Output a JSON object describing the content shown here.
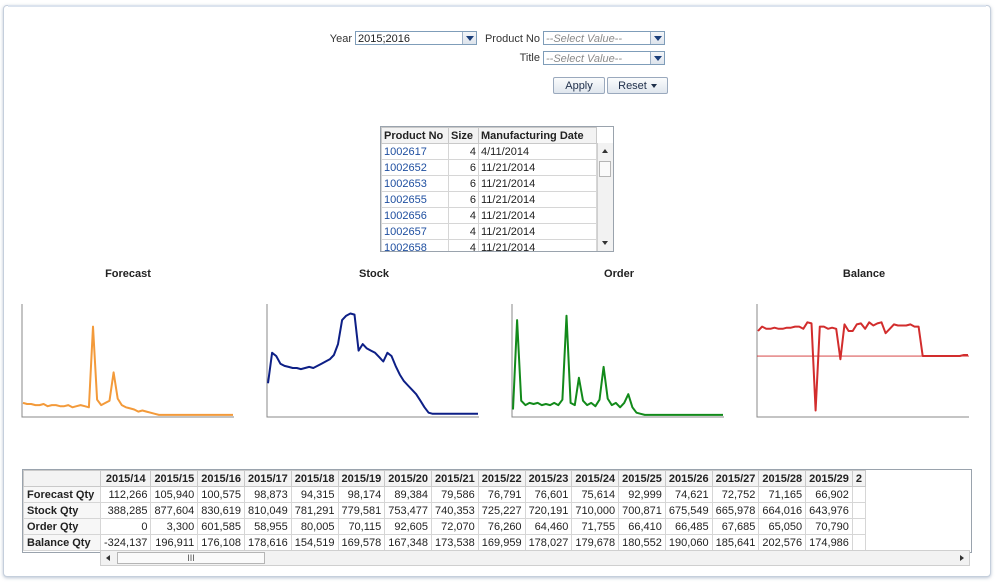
{
  "filters": {
    "year_label": "Year",
    "year_value": "2015;2016",
    "product_label": "Product No",
    "product_placeholder": "--Select Value--",
    "title_label": "Title",
    "title_placeholder": "--Select Value--",
    "apply_label": "Apply",
    "reset_label": "Reset"
  },
  "products": {
    "headers": [
      "Product No",
      "Size",
      "Manufacturing Date"
    ],
    "rows": [
      [
        "1002617",
        "4",
        "4/11/2014"
      ],
      [
        "1002652",
        "6",
        "11/21/2014"
      ],
      [
        "1002653",
        "6",
        "11/21/2014"
      ],
      [
        "1002655",
        "6",
        "11/21/2014"
      ],
      [
        "1002656",
        "4",
        "11/21/2014"
      ],
      [
        "1002657",
        "4",
        "11/21/2014"
      ],
      [
        "1002658",
        "4",
        "11/21/2014"
      ]
    ]
  },
  "charts": {
    "forecast": {
      "title": "Forecast",
      "color": "#f39a3a"
    },
    "stock": {
      "title": "Stock",
      "color": "#0d1f86"
    },
    "order": {
      "title": "Order",
      "color": "#128a1a"
    },
    "balance": {
      "title": "Balance",
      "color": "#d22d2d"
    }
  },
  "chart_data": [
    {
      "type": "line",
      "title": "Forecast",
      "values": [
        12,
        11,
        11,
        10,
        10,
        11,
        9,
        10,
        10,
        9,
        9,
        10,
        8,
        9,
        10,
        9,
        8,
        82,
        15,
        10,
        12,
        14,
        40,
        16,
        10,
        8,
        7,
        6,
        4,
        5,
        4,
        3,
        2,
        1,
        1,
        1,
        1,
        1,
        1,
        1,
        1,
        1,
        1,
        1,
        1,
        1,
        1,
        1,
        1,
        1,
        1,
        1
      ]
    },
    {
      "type": "line",
      "title": "Stock",
      "values": [
        30,
        58,
        55,
        48,
        46,
        45,
        44,
        44,
        43,
        44,
        45,
        44,
        46,
        48,
        50,
        52,
        56,
        66,
        88,
        92,
        94,
        93,
        60,
        66,
        62,
        60,
        58,
        54,
        50,
        58,
        55,
        46,
        38,
        32,
        28,
        24,
        20,
        14,
        8,
        3,
        2,
        2,
        2,
        2,
        2,
        2,
        2,
        2,
        2,
        2,
        2,
        2
      ]
    },
    {
      "type": "line",
      "title": "Order",
      "values": [
        6,
        88,
        14,
        10,
        12,
        11,
        12,
        10,
        11,
        10,
        12,
        10,
        15,
        92,
        12,
        10,
        35,
        14,
        10,
        12,
        9,
        15,
        45,
        16,
        10,
        12,
        8,
        12,
        20,
        8,
        3,
        2,
        1,
        1,
        1,
        1,
        1,
        1,
        1,
        1,
        1,
        1,
        1,
        1,
        1,
        1,
        1,
        1,
        1,
        1,
        1,
        1
      ]
    },
    {
      "type": "line",
      "title": "Balance",
      "values": [
        78,
        82,
        80,
        80,
        81,
        80,
        80,
        81,
        81,
        82,
        82,
        80,
        86,
        85,
        5,
        82,
        82,
        80,
        81,
        80,
        52,
        84,
        78,
        78,
        84,
        85,
        80,
        86,
        83,
        85,
        86,
        76,
        80,
        84,
        83,
        83,
        83,
        84,
        82,
        82,
        55,
        55,
        55,
        55,
        55,
        55,
        55,
        55,
        55,
        55,
        56,
        56
      ],
      "reference_line": true
    }
  ],
  "data_table": {
    "columns": [
      "2015/14",
      "2015/15",
      "2015/16",
      "2015/17",
      "2015/18",
      "2015/19",
      "2015/20",
      "2015/21",
      "2015/22",
      "2015/23",
      "2015/24",
      "2015/25",
      "2015/26",
      "2015/27",
      "2015/28",
      "2015/29",
      "2"
    ],
    "rows": [
      {
        "label": "Forecast Qty",
        "values": [
          "112,266",
          "105,940",
          "100,575",
          "98,873",
          "94,315",
          "98,174",
          "89,384",
          "79,586",
          "76,791",
          "76,601",
          "75,614",
          "92,999",
          "74,621",
          "72,752",
          "71,165",
          "66,902",
          ""
        ]
      },
      {
        "label": "Stock Qty",
        "values": [
          "388,285",
          "877,604",
          "830,619",
          "810,049",
          "781,291",
          "779,581",
          "753,477",
          "740,353",
          "725,227",
          "720,191",
          "710,000",
          "700,871",
          "675,549",
          "665,978",
          "664,016",
          "643,976",
          ""
        ]
      },
      {
        "label": "Order Qty",
        "values": [
          "0",
          "3,300",
          "601,585",
          "58,955",
          "80,005",
          "70,115",
          "92,605",
          "72,070",
          "76,260",
          "64,460",
          "71,755",
          "66,410",
          "66,485",
          "67,685",
          "65,050",
          "70,790",
          ""
        ]
      },
      {
        "label": "Balance Qty",
        "values": [
          "-324,137",
          "196,911",
          "176,108",
          "178,616",
          "154,519",
          "169,578",
          "167,348",
          "173,538",
          "169,959",
          "178,027",
          "179,678",
          "180,552",
          "190,060",
          "185,641",
          "202,576",
          "174,986",
          ""
        ]
      }
    ],
    "scroll_thumb_label": "III"
  }
}
